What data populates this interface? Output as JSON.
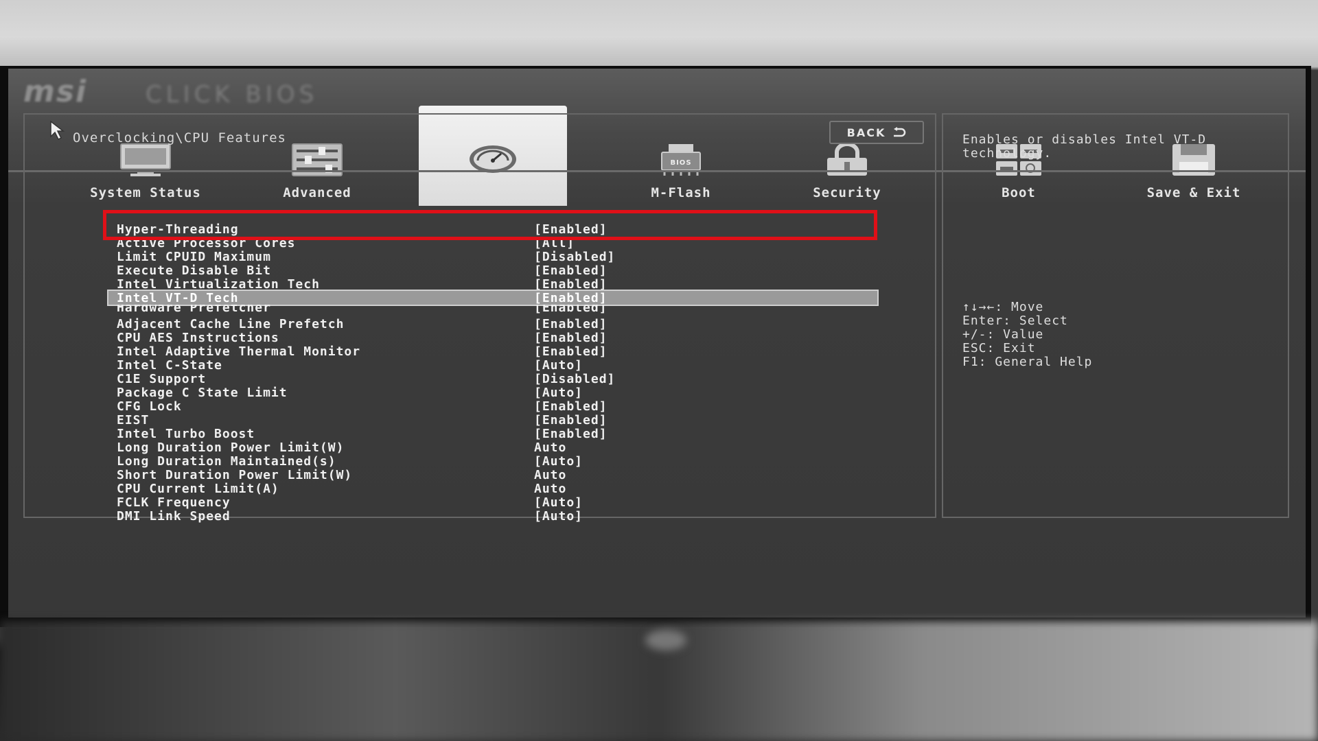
{
  "brand": {
    "logo": "msi",
    "logo_sub": "CLICK BIOS"
  },
  "tabs": [
    {
      "label": "System Status",
      "icon": "monitor-icon",
      "active": false
    },
    {
      "label": "Advanced",
      "icon": "sliders-icon",
      "active": false
    },
    {
      "label": "",
      "icon": "gauge-icon",
      "active": true
    },
    {
      "label": "M-Flash",
      "icon": "bios-chip-icon",
      "active": false
    },
    {
      "label": "Security",
      "icon": "lock-icon",
      "active": false
    },
    {
      "label": "Boot",
      "icon": "boot-grid-icon",
      "active": false
    },
    {
      "label": "Save & Exit",
      "icon": "save-disk-icon",
      "active": false
    }
  ],
  "breadcrumb": "Overclocking\\CPU Features",
  "back_button": {
    "label": "BACK"
  },
  "settings": [
    {
      "label": "Hyper-Threading",
      "value": "[Enabled]"
    },
    {
      "label": "Active Processor Cores",
      "value": "[All]"
    },
    {
      "label": "Limit CPUID Maximum",
      "value": "[Disabled]"
    },
    {
      "label": "Execute Disable Bit",
      "value": "[Enabled]"
    },
    {
      "label": "Intel Virtualization Tech",
      "value": "[Enabled]"
    },
    {
      "label": "Intel VT-D Tech",
      "value": "[Enabled]",
      "selected": true
    },
    {
      "label": "Hardware Prefetcher",
      "value": "[Enabled]"
    },
    {
      "label": "Adjacent Cache Line Prefetch",
      "value": "[Enabled]"
    },
    {
      "label": "CPU AES Instructions",
      "value": "[Enabled]"
    },
    {
      "label": "Intel Adaptive Thermal Monitor",
      "value": "[Enabled]"
    },
    {
      "label": "Intel C-State",
      "value": "[Auto]"
    },
    {
      "label": "C1E Support",
      "value": "[Disabled]"
    },
    {
      "label": "Package C State Limit",
      "value": "[Auto]"
    },
    {
      "label": "CFG Lock",
      "value": "[Enabled]"
    },
    {
      "label": "EIST",
      "value": "[Enabled]"
    },
    {
      "label": "Intel Turbo Boost",
      "value": "[Enabled]"
    },
    {
      "label": "Long Duration Power Limit(W)",
      "value": "Auto"
    },
    {
      "label": "Long Duration Maintained(s)",
      "value": "[Auto]"
    },
    {
      "label": "Short Duration Power Limit(W)",
      "value": "Auto"
    },
    {
      "label": "CPU Current Limit(A)",
      "value": "Auto"
    },
    {
      "label": "FCLK Frequency",
      "value": "[Auto]"
    },
    {
      "label": "DMI Link Speed",
      "value": "[Auto]"
    }
  ],
  "help": {
    "description": "Enables or disables Intel VT-D technology.",
    "keys": [
      "↑↓→←: Move",
      "Enter: Select",
      "+/-: Value",
      "ESC: Exit",
      "F1: General Help"
    ]
  },
  "colors": {
    "annotation_box": "#e01018",
    "selected_row": "#9a9a9a",
    "active_tab": "#e8e8e8"
  }
}
